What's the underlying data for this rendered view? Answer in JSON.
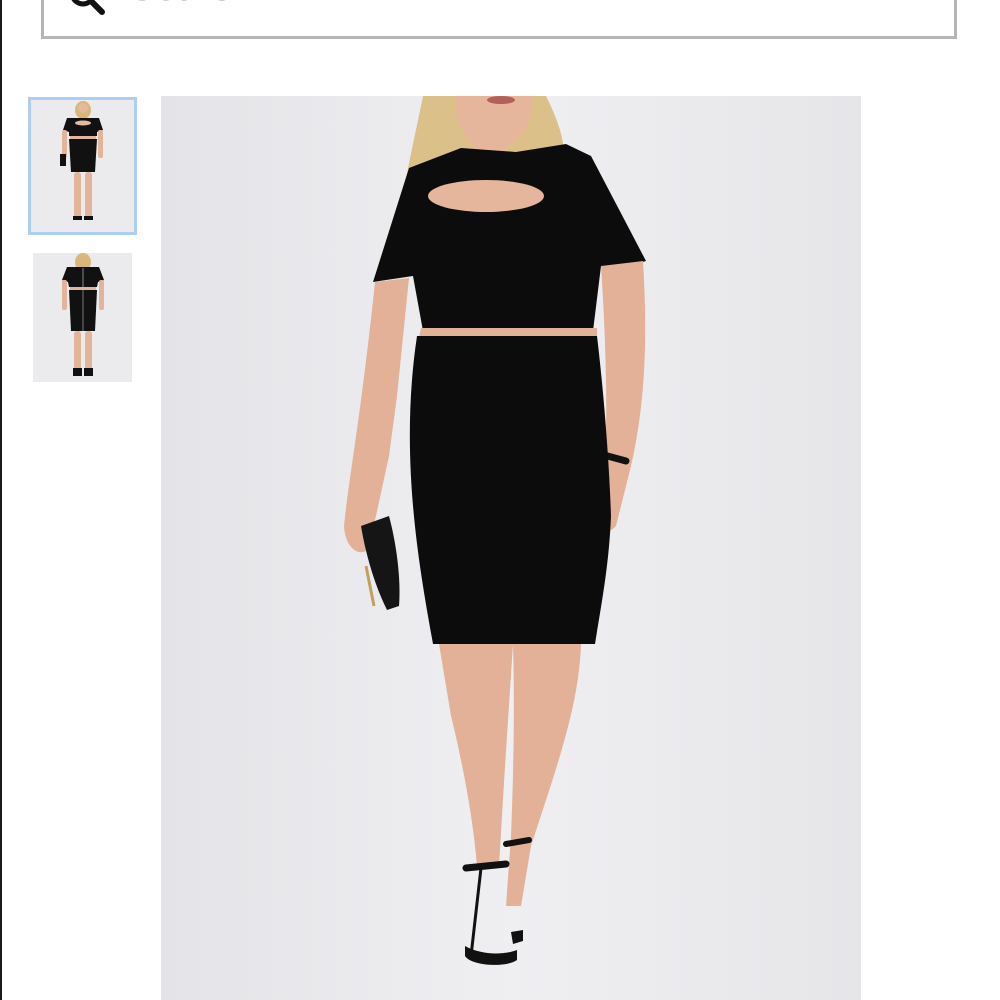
{
  "search": {
    "placeholder": "Search",
    "icon": "search-icon"
  },
  "gallery": {
    "thumbnails": [
      {
        "selected": true
      },
      {
        "selected": false
      }
    ],
    "selected_border_color": "#aecdf2"
  }
}
